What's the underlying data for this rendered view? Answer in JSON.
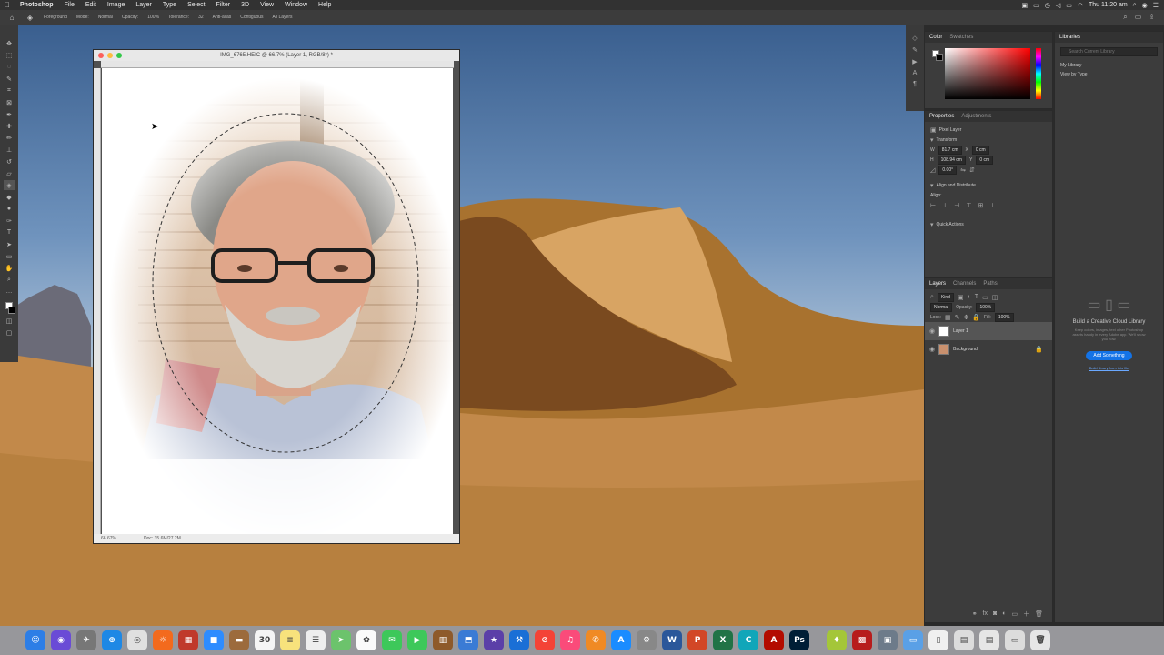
{
  "menubar": {
    "app": "Photoshop",
    "menus": [
      "File",
      "Edit",
      "Image",
      "Layer",
      "Type",
      "Select",
      "Filter",
      "3D",
      "View",
      "Window",
      "Help"
    ],
    "clock": "Thu 11:20 am"
  },
  "options": {
    "preset": "Foreground",
    "mode_label": "Mode:",
    "mode_value": "Normal",
    "opacity_label": "Opacity:",
    "opacity_value": "100%",
    "tolerance_label": "Tolerance:",
    "tolerance_value": "32",
    "antialias": "Anti-alias",
    "contiguous": "Contiguous",
    "all_layers": "All Layers"
  },
  "document": {
    "title": "IMG_6765.HEIC @ 66.7% (Layer 1, RGB/8*) *",
    "zoom": "66.67%",
    "doc_size": "Doc: 35.6M/27.2M"
  },
  "color_panel": {
    "tabs": [
      "Color",
      "Swatches"
    ]
  },
  "properties": {
    "tabs": [
      "Properties",
      "Adjustments"
    ],
    "layer_type": "Pixel Layer",
    "transform_label": "Transform",
    "w_label": "W",
    "w_value": "81.7 cm",
    "h_label": "H",
    "h_value": "108.94 cm",
    "x_label": "X",
    "x_value": "0 cm",
    "y_label": "Y",
    "y_value": "0 cm",
    "angle": "0.00°",
    "align_label": "Align and Distribute",
    "align_sub": "Align:",
    "quick_actions": "Quick Actions"
  },
  "layers_panel": {
    "tabs": [
      "Layers",
      "Channels",
      "Paths"
    ],
    "filter_label": "Kind",
    "blend_mode": "Normal",
    "opacity_label": "Opacity:",
    "opacity_value": "100%",
    "lock_label": "Lock:",
    "fill_label": "Fill:",
    "fill_value": "100%",
    "layers": [
      {
        "name": "Layer 1",
        "selected": true
      },
      {
        "name": "Background",
        "selected": false
      }
    ]
  },
  "libraries": {
    "tab": "Libraries",
    "search_placeholder": "Search Current Library",
    "library": "My Library",
    "view_by": "View by Type",
    "empty_title": "Build a Creative Cloud Library",
    "empty_desc": "Keep colors, images, text other Photoshop assets handy in every Adobe app. We'll show you how.",
    "add_button": "Add Something",
    "link": "Build library from this file"
  },
  "dock": {
    "apps": [
      {
        "name": "finder",
        "bg": "#2d7ee6",
        "glyph": "☺"
      },
      {
        "name": "siri",
        "bg": "#6a4bd6",
        "glyph": "◉"
      },
      {
        "name": "launchpad",
        "bg": "#777",
        "glyph": "✈"
      },
      {
        "name": "safari",
        "bg": "#1e88e5",
        "glyph": "⊕"
      },
      {
        "name": "chrome",
        "bg": "#e0e0e0",
        "glyph": "◎"
      },
      {
        "name": "firefox",
        "bg": "#f36a1d",
        "glyph": "☼"
      },
      {
        "name": "photos-library",
        "bg": "#c0392b",
        "glyph": "▦"
      },
      {
        "name": "zoom",
        "bg": "#2d8cff",
        "glyph": "■"
      },
      {
        "name": "notes-brown",
        "bg": "#9c6b3c",
        "glyph": "▬"
      },
      {
        "name": "calendar",
        "bg": "#f5f5f5",
        "glyph": "30"
      },
      {
        "name": "notes",
        "bg": "#f7e27c",
        "glyph": "≡"
      },
      {
        "name": "reminders",
        "bg": "#eee",
        "glyph": "☰"
      },
      {
        "name": "maps",
        "bg": "#6cc36c",
        "glyph": "➤"
      },
      {
        "name": "photos",
        "bg": "#fafafa",
        "glyph": "✿"
      },
      {
        "name": "messages",
        "bg": "#3dc85a",
        "glyph": "✉"
      },
      {
        "name": "facetime",
        "bg": "#3dc85a",
        "glyph": "▶"
      },
      {
        "name": "books",
        "bg": "#8e5a2b",
        "glyph": "▥"
      },
      {
        "name": "keynote",
        "bg": "#3a7bd5",
        "glyph": "⬒"
      },
      {
        "name": "imovie",
        "bg": "#5b3fa8",
        "glyph": "★"
      },
      {
        "name": "xcode",
        "bg": "#1a6fd6",
        "glyph": "⚒"
      },
      {
        "name": "news",
        "bg": "#f44336",
        "glyph": "⊘"
      },
      {
        "name": "music",
        "bg": "#fa4b7a",
        "glyph": "♫"
      },
      {
        "name": "podcasts",
        "bg": "#f08a24",
        "glyph": "✆"
      },
      {
        "name": "app-store",
        "bg": "#1a8cff",
        "glyph": "A"
      },
      {
        "name": "system-preferences",
        "bg": "#888",
        "glyph": "⚙"
      },
      {
        "name": "word",
        "bg": "#2b579a",
        "glyph": "W"
      },
      {
        "name": "powerpoint",
        "bg": "#d24726",
        "glyph": "P"
      },
      {
        "name": "excel",
        "bg": "#217346",
        "glyph": "X"
      },
      {
        "name": "cleanmymac",
        "bg": "#11a6b9",
        "glyph": "C"
      },
      {
        "name": "acrobat",
        "bg": "#b30b00",
        "glyph": "A"
      },
      {
        "name": "photoshop",
        "bg": "#001e36",
        "glyph": "Ps"
      },
      {
        "name": "android-file",
        "bg": "#a4c639",
        "glyph": "♦"
      },
      {
        "name": "photo-booth",
        "bg": "#b71c1c",
        "glyph": "▩"
      },
      {
        "name": "preview",
        "bg": "#6d7b8a",
        "glyph": "▣"
      },
      {
        "name": "documents-folder",
        "bg": "#5aa0e6",
        "glyph": "▭"
      },
      {
        "name": "file",
        "bg": "#f0f0f0",
        "glyph": "▯"
      },
      {
        "name": "downloads",
        "bg": "#dcdcdc",
        "glyph": "▤"
      },
      {
        "name": "screenshots",
        "bg": "#e6e6e6",
        "glyph": "▤"
      },
      {
        "name": "folder",
        "bg": "#dcdcdc",
        "glyph": "▭"
      },
      {
        "name": "trash",
        "bg": "#e6e6e6",
        "glyph": "🗑"
      }
    ]
  }
}
